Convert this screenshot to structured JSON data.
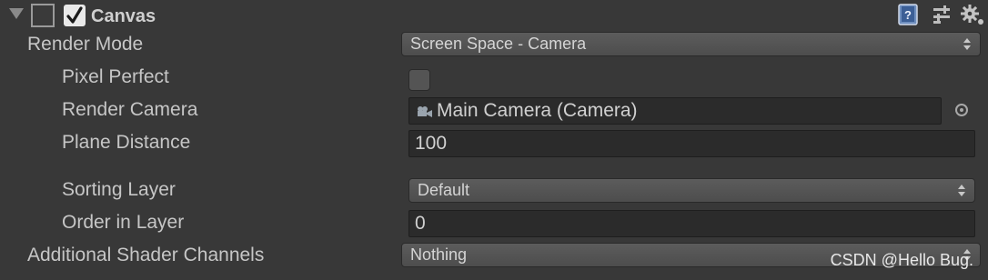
{
  "header": {
    "title": "Canvas",
    "enabled": true
  },
  "properties": {
    "render_mode": {
      "label": "Render Mode",
      "value": "Screen Space - Camera"
    },
    "pixel_perfect": {
      "label": "Pixel Perfect",
      "checked": false
    },
    "render_camera": {
      "label": "Render Camera",
      "value": "Main Camera (Camera)"
    },
    "plane_distance": {
      "label": "Plane Distance",
      "value": "100"
    },
    "sorting_layer": {
      "label": "Sorting Layer",
      "value": "Default"
    },
    "order_in_layer": {
      "label": "Order in Layer",
      "value": "0"
    },
    "additional_shader_channels": {
      "label": "Additional Shader Channels",
      "value": "Nothing"
    }
  },
  "icons": {
    "foldout": "triangle-down-icon",
    "component": "canvas-component-icon",
    "help": "help-book-icon",
    "presets": "sliders-icon",
    "settings": "gear-icon",
    "camera": "camera-icon",
    "object_picker": "target-icon"
  },
  "watermark": "CSDN @Hello Bug."
}
